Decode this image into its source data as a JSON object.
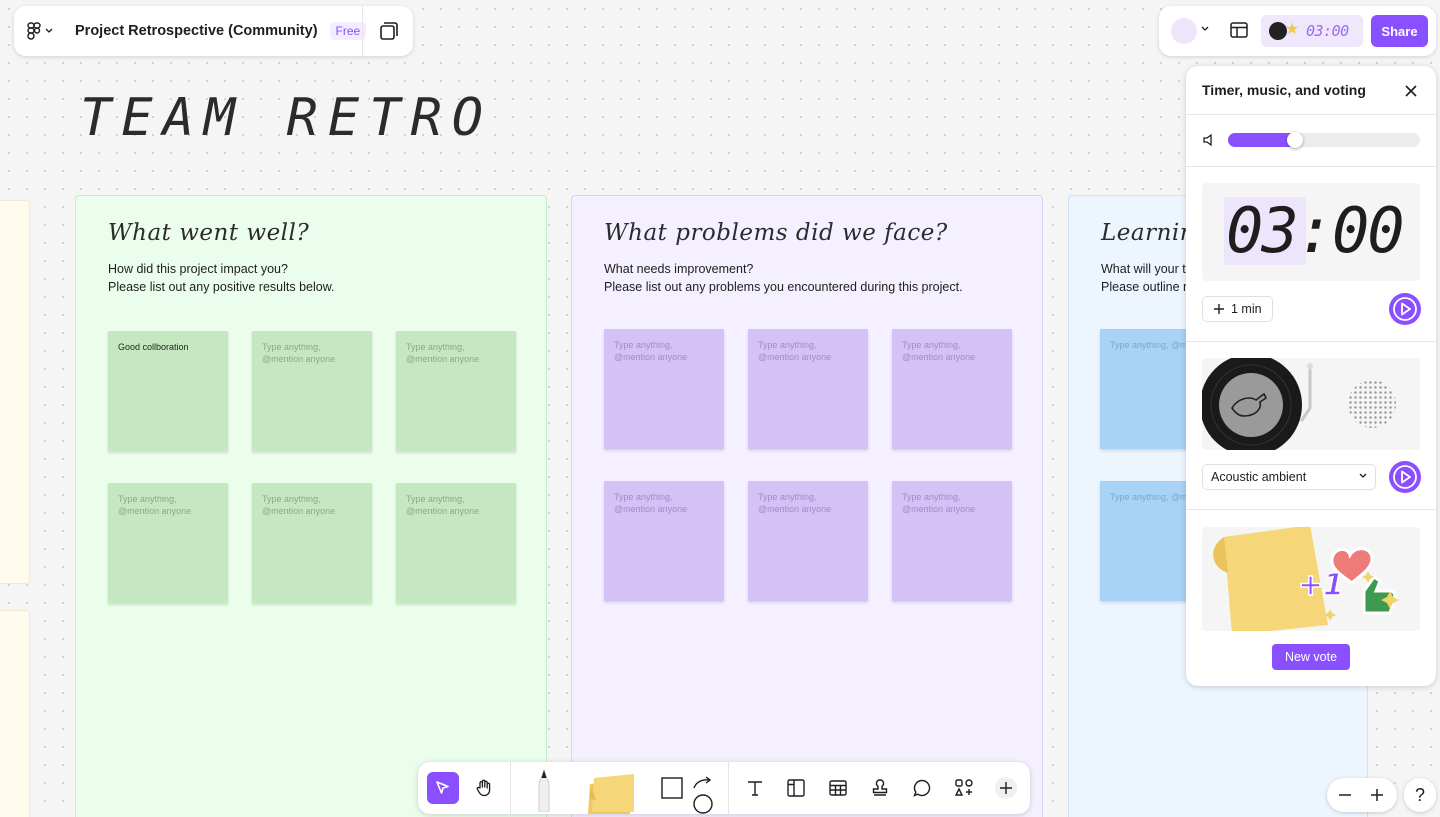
{
  "app": {
    "file_title": "Project Retrospective (Community)",
    "plan_badge": "Free",
    "share_label": "Share",
    "header_timer": "03:00"
  },
  "canvas": {
    "board_title": "TEAM RETRO",
    "sections": [
      {
        "heading": "What went well?",
        "desc_line1": "How did this project impact you?",
        "desc_line2": "Please list out any positive results below.",
        "stickies": [
          "Good collboration",
          "Type anything, @mention anyone",
          "Type anything, @mention anyone",
          "Type anything, @mention anyone",
          "Type anything, @mention anyone",
          "Type anything, @mention anyone"
        ]
      },
      {
        "heading": "What problems did we face?",
        "desc_line1": "What needs improvement?",
        "desc_line2": "Please list out any problems you encountered during this project.",
        "stickies": [
          "Type anything, @mention anyone",
          "Type anything, @mention anyone",
          "Type anything, @mention anyone",
          "Type anything, @mention anyone",
          "Type anything, @mention anyone",
          "Type anything, @mention anyone"
        ]
      },
      {
        "heading": "Learnin",
        "desc_line1": "What will your t",
        "desc_line2": "Please outline n",
        "stickies": [
          "Type anything, @m",
          "Type anything, @m"
        ]
      }
    ]
  },
  "panel": {
    "title": "Timer, music, and voting",
    "volume_level": 0.32,
    "timer_display": "03:00",
    "add_time_label": "1 min",
    "song_selected": "Acoustic ambient",
    "new_vote_label": "New vote"
  },
  "colors": {
    "accent": "#8a4fff",
    "sticky_green": "#c5e8c0",
    "sticky_purple": "#d4c2f7",
    "sticky_blue": "#a9d2f7"
  },
  "icons": {
    "main_menu": "figjam-logo-icon",
    "pages": "pages-icon",
    "layout": "layout-icon",
    "close": "close-icon",
    "volume": "speaker-icon",
    "play": "play-icon",
    "zoom_out": "minus-icon",
    "zoom_in": "plus-icon",
    "help": "question-icon"
  },
  "zoom": {
    "help_glyph": "?"
  }
}
